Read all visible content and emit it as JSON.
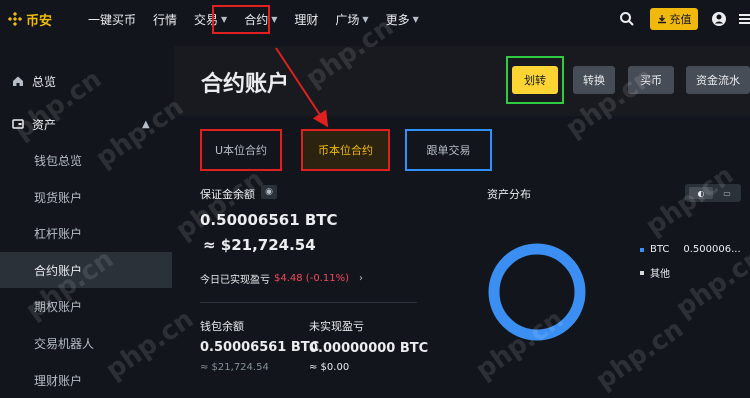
{
  "brand": {
    "name": "币安",
    "color": "#f0b90b"
  },
  "nav": {
    "items": [
      {
        "label": "一键买币",
        "dropdown": false
      },
      {
        "label": "行情",
        "dropdown": false
      },
      {
        "label": "交易",
        "dropdown": true
      },
      {
        "label": "合约",
        "dropdown": true
      },
      {
        "label": "理财",
        "dropdown": false
      },
      {
        "label": "广场",
        "dropdown": true
      },
      {
        "label": "更多",
        "dropdown": true
      }
    ],
    "deposit_label": "充值"
  },
  "sidebar": {
    "overview": "总览",
    "assets": "资产",
    "items": [
      {
        "label": "钱包总览"
      },
      {
        "label": "现货账户"
      },
      {
        "label": "杠杆账户"
      },
      {
        "label": "合约账户"
      },
      {
        "label": "期权账户"
      },
      {
        "label": "交易机器人"
      },
      {
        "label": "理财账户"
      }
    ]
  },
  "header": {
    "title": "合约账户",
    "buttons": {
      "transfer": "划转",
      "convert": "转换",
      "buy": "买币",
      "history": "资金流水"
    }
  },
  "tabs": {
    "usdm": "U本位合约",
    "coinm": "币本位合约",
    "copy": "跟单交易"
  },
  "summary": {
    "margin_label": "保证金余额",
    "margin_btc": "0.50006561 BTC",
    "margin_usd": "≈ $21,724.54",
    "pnl_label": "今日已实现盈亏",
    "pnl_value": "$4.48 (-0.11%)",
    "wallet_label": "钱包余额",
    "wallet_btc": "0.50006561 BTC",
    "wallet_usd": "≈ $21,724.54",
    "unrealized_label": "未实现盈亏",
    "unrealized_btc": "0.00000000 BTC",
    "unrealized_usd": "≈ $0.00"
  },
  "distribution": {
    "title": "资产分布",
    "legend": [
      {
        "name": "BTC",
        "value": "0.500006...",
        "color": "#3b8ff3"
      },
      {
        "name": "其他",
        "value": "",
        "color": "#d9d9d9"
      }
    ],
    "donut_color": "#3b8ff3"
  },
  "watermark": "php.cn",
  "colors": {
    "accent": "#fcd535",
    "negative": "#f6465d",
    "annotation_red": "#e02020",
    "annotation_green": "#2ecc40",
    "annotation_blue": "#3090ff"
  }
}
